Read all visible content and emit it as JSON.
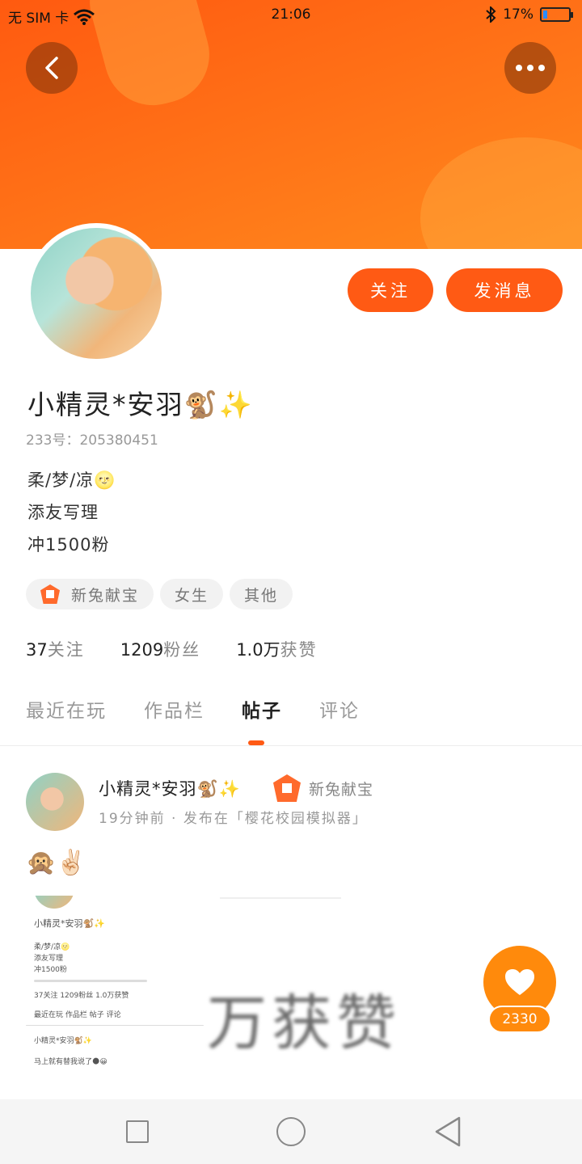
{
  "status_bar": {
    "carrier": "无 SIM 卡",
    "time": "21:06",
    "battery": "17%",
    "battery_level": 0.17
  },
  "profile": {
    "name": "小精灵*安羽🐒✨",
    "uid": "233号：205380451",
    "bio": [
      "柔/梦/凉🌝",
      "添友写理",
      "冲1500粉"
    ],
    "follow_label": "关注",
    "message_label": "发消息"
  },
  "tags": [
    {
      "label": "新兔献宝",
      "icon": "badge-icon"
    },
    {
      "label": "女生"
    },
    {
      "label": "其他"
    }
  ],
  "stats": [
    {
      "value": "37",
      "label": "关注"
    },
    {
      "value": "1209",
      "label": "粉丝"
    },
    {
      "value": "1.0万",
      "label": "获赞"
    }
  ],
  "tabs": [
    "最近在玩",
    "作品栏",
    "帖子",
    "评论"
  ],
  "active_tab": "帖子",
  "post": {
    "author": "小精灵*安羽🐒✨",
    "badge": "新兔献宝",
    "meta": "19分钟前 · 发布在「樱花校园模拟器」",
    "text": "🙊✌🏻",
    "image_overlay_text": "万获赞",
    "mini": {
      "name": "小精灵*安羽🐒✨",
      "lines": [
        "柔/梦/凉🌝",
        "添友写理",
        "冲1500粉"
      ],
      "stats": "37关注  1209粉丝  1.0万获赞",
      "tabs": "最近在玩  作品栏  帖子  评论",
      "post_text": "马上就有替我说了🌑😀"
    }
  },
  "likes": {
    "count": "2330"
  },
  "colors": {
    "accent": "#ff5a14",
    "banner": "#ff7418",
    "like": "#ff8a0c"
  }
}
